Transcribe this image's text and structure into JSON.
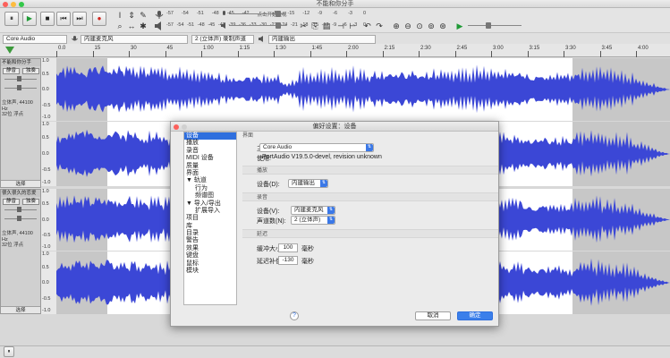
{
  "window": {
    "title": "不能和你分手"
  },
  "transport": {
    "pause": "⏸",
    "play": "▶",
    "stop": "■",
    "skip_start": "⏮",
    "skip_end": "⏭",
    "record": "●"
  },
  "tools": {
    "select": "I",
    "envelope": "⇕",
    "draw": "✎",
    "zoom": "⌕",
    "timeshift": "↔",
    "multi": "✱"
  },
  "meters": {
    "record_ticks": [
      "-57",
      "-54",
      "-51",
      "-48",
      "-45",
      "-42",
      "点击开始监视",
      "-18",
      "-15",
      "-12",
      "-9",
      "-6",
      "-3",
      "0"
    ],
    "play_ticks": [
      "-57",
      "-54",
      "-51",
      "-48",
      "-45",
      "-42",
      "-39",
      "-36",
      "-33",
      "-30",
      "-27",
      "-24",
      "-21",
      "-18",
      "-15",
      "-12",
      "-9",
      "-6",
      "-3",
      "0"
    ]
  },
  "devices": {
    "host": "Core Audio",
    "recording_device": "内建麦克风",
    "channels": "2 (立体声) 录制声道",
    "playback_device": "内建输出"
  },
  "ruler": {
    "ticks": [
      "0.0",
      "15",
      "30",
      "45",
      "1:00",
      "1:15",
      "1:30",
      "1:45",
      "2:00",
      "2:15",
      "2:30",
      "2:45",
      "3:00",
      "3:15",
      "3:30",
      "3:45",
      "4:00"
    ]
  },
  "tracks": [
    {
      "name": "不能和你分手",
      "mute": "静音",
      "solo": "独奏",
      "info": [
        "立体声, 44100 Hz",
        "32位 浮点"
      ],
      "select": "选择"
    },
    {
      "name": "很久很久的恋爱",
      "mute": "静音",
      "solo": "独奏",
      "info": [
        "立体声, 44100 Hz",
        "32位 浮点"
      ],
      "select": "选择"
    }
  ],
  "scale": [
    "1.0",
    "0.5",
    "0.0",
    "-0.5",
    "-1.0"
  ],
  "dialog": {
    "title": "偏好设置：设备",
    "nav": [
      "设备",
      "播放",
      "录音",
      "MIDI 设备",
      "质量",
      "界面",
      "▼ 轨道",
      "行为",
      "频谱图",
      "▼ 导入/导出",
      "扩展导入",
      "项目",
      "库",
      "目录",
      "警告",
      "效果",
      "键盘",
      "鼠标",
      "模块"
    ],
    "nav_selected": 0,
    "interface": {
      "section": "界面",
      "host_label": "主机(H):",
      "host_value": "Core Audio",
      "using_label": "使用:",
      "using_value": "PortAudio V19.5.0-devel, revision unknown"
    },
    "playback": {
      "section": "播放",
      "device_label": "设备(D):",
      "device_value": "内建输出"
    },
    "recording": {
      "section": "录音",
      "device_label": "设备(V):",
      "device_value": "内建麦克风",
      "channels_label": "声道数(N):",
      "channels_value": "2 (立体声)"
    },
    "latency": {
      "section": "延迟",
      "buffer_label": "缓冲大小(B):",
      "buffer_value": "100",
      "buffer_unit": "毫秒",
      "comp_label": "延迟补偿 (L) :",
      "comp_value": "-130",
      "comp_unit": "毫秒"
    },
    "help": "?",
    "cancel": "取消",
    "ok": "确定"
  },
  "colors": {
    "wave": "#3b47d6",
    "wave_bg": "#c7c7c7",
    "selected_bg": "#ffffff",
    "accent": "#2f6fde"
  }
}
